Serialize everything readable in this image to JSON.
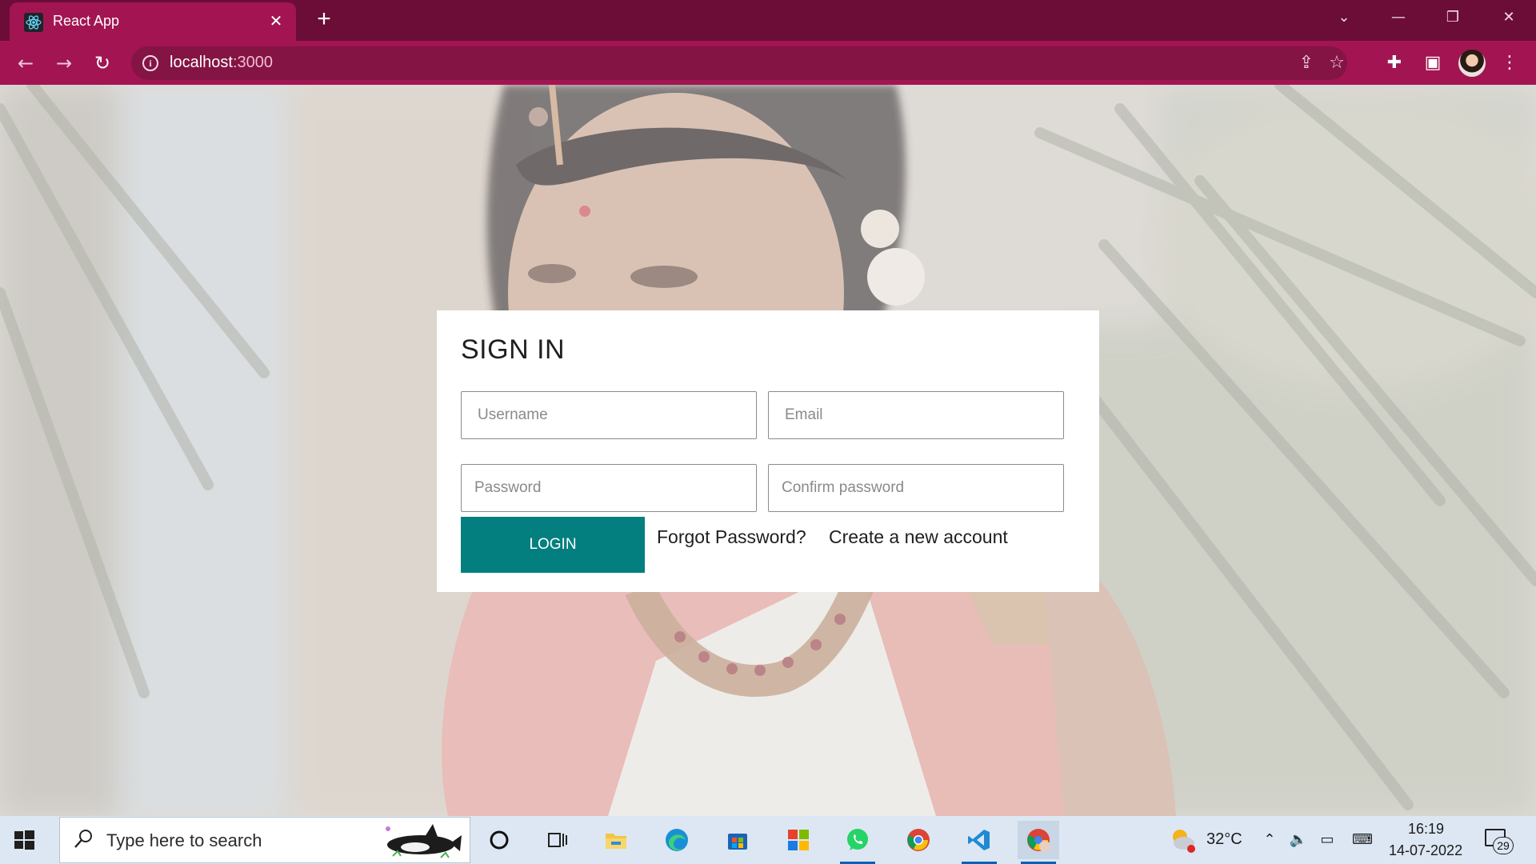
{
  "browser": {
    "tab_title": "React App",
    "url_host": "localhost",
    "url_port": ":3000",
    "accent": "#a21552"
  },
  "signin": {
    "title": "SIGN IN",
    "username_placeholder": "Username",
    "email_placeholder": "Email",
    "password_placeholder": "Password",
    "confirm_password_placeholder": "Confirm password",
    "login_label": "LOGIN",
    "forgot_label": "Forgot Password?",
    "create_account_label": "Create a new account",
    "button_color": "#047f80"
  },
  "taskbar": {
    "search_placeholder": "Type here to search",
    "weather_temp": "32°C",
    "time": "16:19",
    "date": "14-07-2022",
    "notification_count": "29",
    "apps": [
      "cortana-icon",
      "task-view-icon",
      "file-explorer-icon",
      "edge-icon",
      "store-icon",
      "office-icon",
      "whatsapp-icon",
      "chrome-icon",
      "vscode-icon",
      "chrome-profile-icon"
    ]
  }
}
